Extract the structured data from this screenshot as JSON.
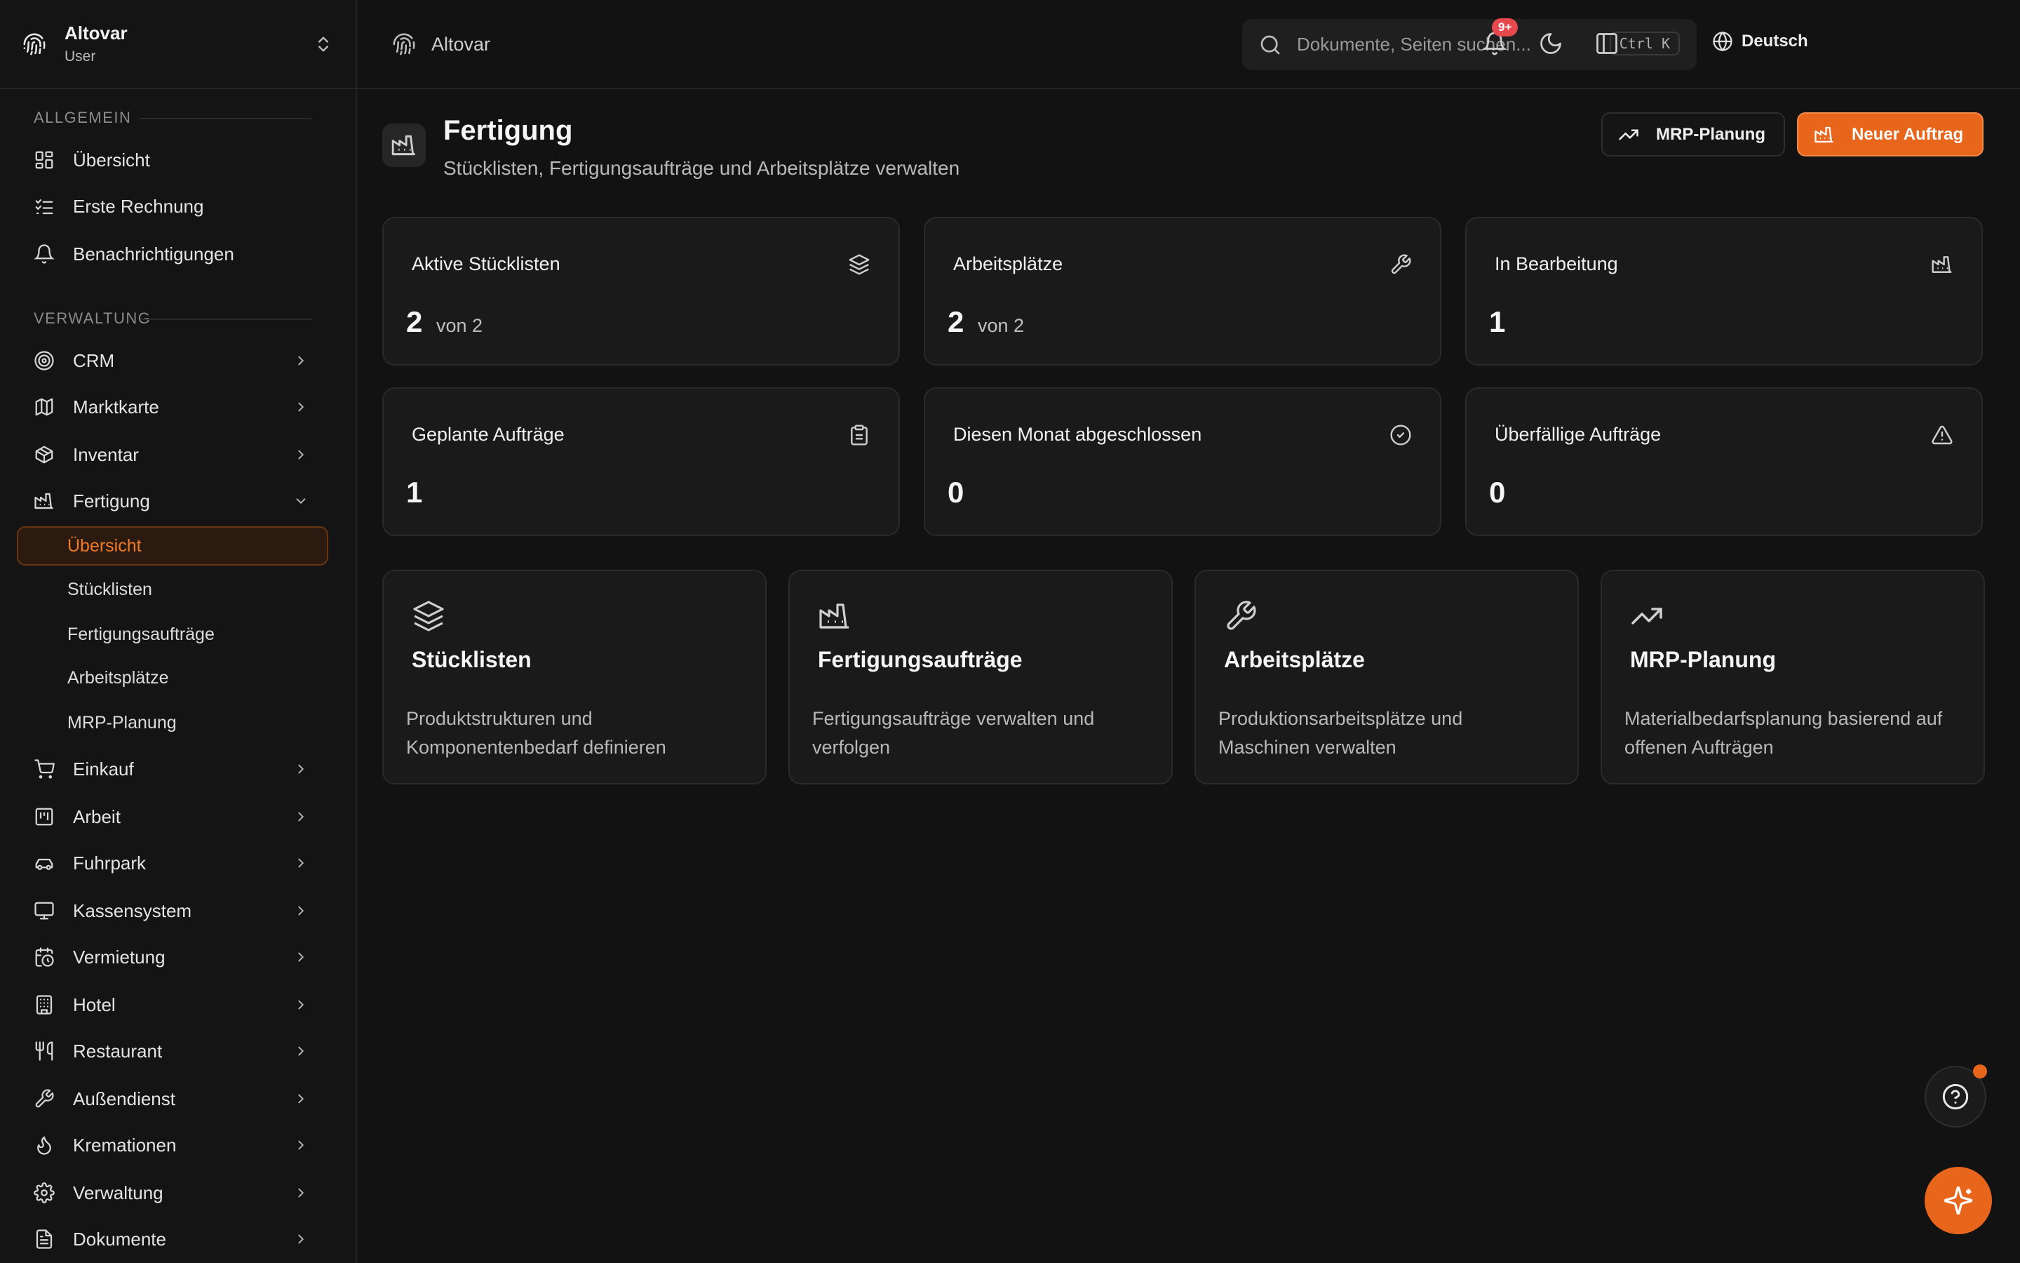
{
  "app": {
    "name": "Altovar",
    "role": "User"
  },
  "topbar": {
    "breadcrumb": "Altovar",
    "search": {
      "placeholder": "Dokumente, Seiten suchen...",
      "shortcut": "Ctrl K"
    },
    "language": "Deutsch",
    "notification_badge": "9+"
  },
  "sidebar": {
    "sections": {
      "general": "Allgemein",
      "admin": "Verwaltung"
    },
    "general_items": [
      {
        "label": "Übersicht",
        "icon": "dashboard-icon"
      },
      {
        "label": "Erste Rechnung",
        "icon": "checklist-icon"
      },
      {
        "label": "Benachrichtigungen",
        "icon": "bell-icon"
      }
    ],
    "admin_items": [
      {
        "label": "CRM",
        "icon": "target-icon"
      },
      {
        "label": "Marktkarte",
        "icon": "map-icon"
      },
      {
        "label": "Inventar",
        "icon": "package-icon"
      },
      {
        "label": "Fertigung",
        "icon": "factory-icon",
        "expanded": true
      }
    ],
    "fertigung_sub": [
      {
        "label": "Übersicht",
        "active": true
      },
      {
        "label": "Stücklisten"
      },
      {
        "label": "Fertigungsaufträge"
      },
      {
        "label": "Arbeitsplätze"
      },
      {
        "label": "MRP-Planung"
      }
    ],
    "more_items": [
      {
        "label": "Einkauf",
        "icon": "cart-icon"
      },
      {
        "label": "Arbeit",
        "icon": "kanban-icon"
      },
      {
        "label": "Fuhrpark",
        "icon": "car-icon"
      },
      {
        "label": "Kassensystem",
        "icon": "monitor-icon"
      },
      {
        "label": "Vermietung",
        "icon": "calendar-clock-icon"
      },
      {
        "label": "Hotel",
        "icon": "building-icon"
      },
      {
        "label": "Restaurant",
        "icon": "utensils-icon"
      },
      {
        "label": "Außendienst",
        "icon": "wrench-icon"
      },
      {
        "label": "Kremationen",
        "icon": "flame-icon"
      },
      {
        "label": "Verwaltung",
        "icon": "gear-icon"
      },
      {
        "label": "Dokumente",
        "icon": "document-icon"
      }
    ]
  },
  "page": {
    "title": "Fertigung",
    "subtitle": "Stücklisten, Fertigungsaufträge und Arbeitsplätze verwalten",
    "actions": {
      "mrp": "MRP-Planung",
      "new_order": "Neuer Auftrag"
    }
  },
  "stats": [
    {
      "label": "Aktive Stücklisten",
      "value": "2",
      "suffix": "von 2",
      "icon": "layers-icon"
    },
    {
      "label": "Arbeitsplätze",
      "value": "2",
      "suffix": "von 2",
      "icon": "wrench-icon"
    },
    {
      "label": "In Bearbeitung",
      "value": "1",
      "suffix": "",
      "icon": "factory-icon"
    },
    {
      "label": "Geplante Aufträge",
      "value": "1",
      "suffix": "",
      "icon": "clipboard-icon"
    },
    {
      "label": "Diesen Monat abgeschlossen",
      "value": "0",
      "suffix": "",
      "icon": "check-circle-icon"
    },
    {
      "label": "Überfällige Aufträge",
      "value": "0",
      "suffix": "",
      "icon": "alert-triangle-icon"
    }
  ],
  "modules": [
    {
      "title": "Stücklisten",
      "desc": "Produktstrukturen und Komponentenbedarf definieren",
      "icon": "layers-icon"
    },
    {
      "title": "Fertigungsaufträge",
      "desc": "Fertigungsaufträge verwalten und verfolgen",
      "icon": "factory-icon"
    },
    {
      "title": "Arbeitsplätze",
      "desc": "Produktionsarbeitsplätze und Maschinen verwalten",
      "icon": "wrench-icon"
    },
    {
      "title": "MRP-Planung",
      "desc": "Materialbedarfsplanung basierend auf offenen Aufträgen",
      "icon": "trending-up-icon"
    }
  ],
  "colors": {
    "accent": "#e8651c",
    "background": "#121212",
    "card": "#1a1a1a",
    "badge": "#e5484d"
  }
}
